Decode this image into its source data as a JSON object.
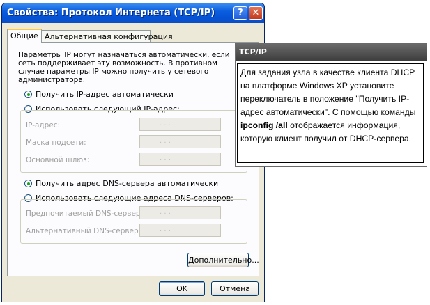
{
  "window": {
    "title": "Свойства: Протокол Интернета (TCP/IP)",
    "help_btn": "?",
    "close_btn": "✕"
  },
  "tabs": [
    {
      "label": "Общие"
    },
    {
      "label": "Альтернативная конфигурация"
    }
  ],
  "description": "Параметры IP могут назначаться автоматически, если сеть поддерживает эту возможность. В противном случае параметры IP можно получить у сетевого администратора.",
  "ip_radios": {
    "auto": {
      "label": "Получить IP-адрес автоматически",
      "checked": true
    },
    "manual": {
      "label": "Использовать следующий IP-адрес:",
      "checked": false
    }
  },
  "ip_fields": [
    {
      "label": "IP-адрес:"
    },
    {
      "label": "Маска подсети:"
    },
    {
      "label": "Основной шлюз:"
    }
  ],
  "dns_radios": {
    "auto": {
      "label": "Получить адрес DNS-сервера автоматически",
      "checked": true
    },
    "manual": {
      "label": "Использовать следующие адреса DNS-серверов:",
      "checked": false
    }
  },
  "dns_fields": [
    {
      "label": "Предпочитаемый DNS-сервер:"
    },
    {
      "label": "Альтернативный DNS-сервер:"
    }
  ],
  "ip_dots": ".   .   .",
  "buttons": {
    "advanced": "Дополнительно...",
    "ok": "OK",
    "cancel": "Отмена"
  },
  "callout": {
    "title": "TCP/IP",
    "text_before": "Для задания узла в качестве клиента DHCP на платформе Windows XP установите переключатель в положение \"Получить IP-адрес автоматически\". С помощью команды ",
    "command": "ipconfig /all",
    "text_after": " отображается информация, которую клиент получил от DHCP-сервера."
  }
}
